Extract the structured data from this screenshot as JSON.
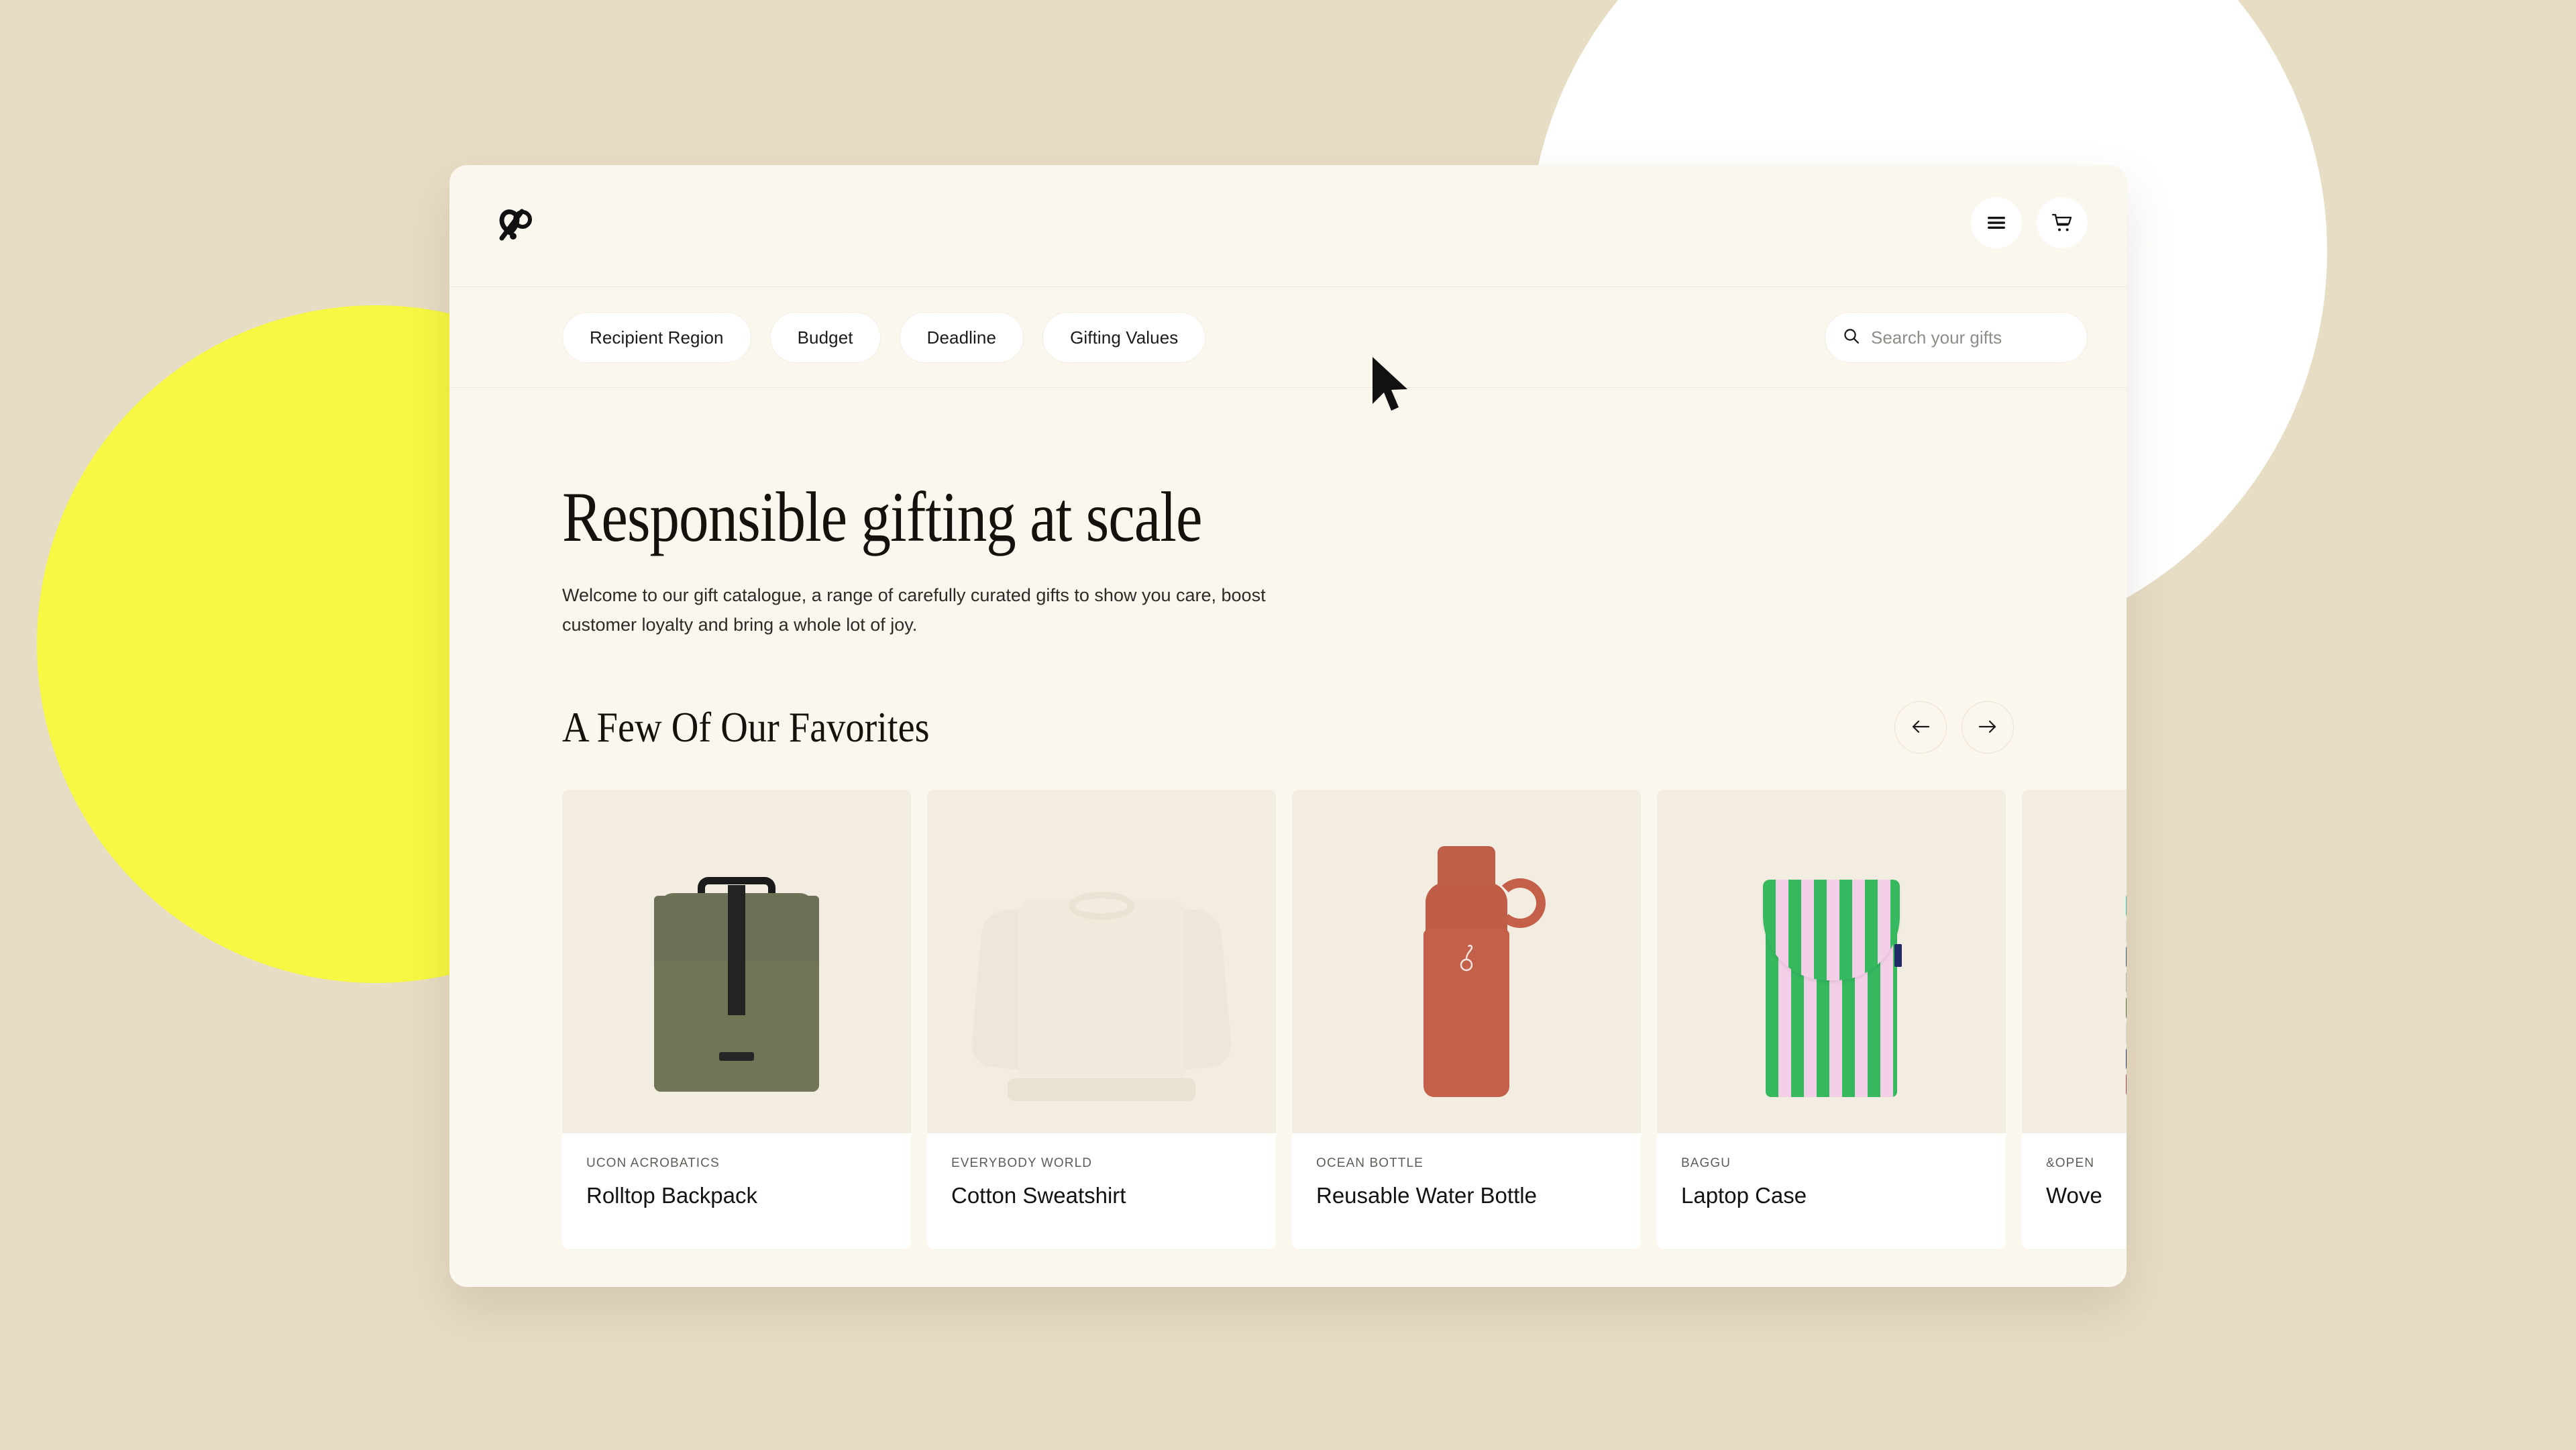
{
  "brand": {
    "logo_icon": "looped-ampersand-logo"
  },
  "topbar": {
    "menu_icon": "hamburger-menu-icon",
    "cart_icon": "shopping-cart-icon"
  },
  "filters": {
    "pills": [
      {
        "label": "Recipient Region"
      },
      {
        "label": "Budget"
      },
      {
        "label": "Deadline"
      },
      {
        "label": "Gifting Values"
      }
    ]
  },
  "search": {
    "icon": "search-icon",
    "placeholder": "Search your gifts",
    "value": ""
  },
  "hero": {
    "title": "Responsible gifting at scale",
    "subtitle": "Welcome to our gift catalogue, a range of carefully curated gifts to show you care, boost customer loyalty and bring a whole lot of joy."
  },
  "favorites": {
    "heading": "A Few Of Our Favorites",
    "prev_icon": "arrow-left-icon",
    "next_icon": "arrow-right-icon",
    "products": [
      {
        "brand": "UCON ACROBATICS",
        "name": "Rolltop Backpack",
        "image": "olive-rolltop-backpack"
      },
      {
        "brand": "EVERYBODY WORLD",
        "name": "Cotton Sweatshirt",
        "image": "cream-crewneck-sweatshirt"
      },
      {
        "brand": "OCEAN BOTTLE",
        "name": "Reusable Water Bottle",
        "image": "terracotta-water-bottle"
      },
      {
        "brand": "BAGGU",
        "name": "Laptop Case",
        "image": "green-pink-striped-laptop-sleeve"
      },
      {
        "brand": "&OPEN",
        "name": "Wove",
        "image": "stacked-woven-throws"
      }
    ]
  },
  "colors": {
    "page_background": "#e7dcc4",
    "accent_yellow": "#f7f843",
    "circle_white": "#ffffff",
    "app_background": "#fbf7ef",
    "card_background": "#ffffff",
    "text_primary": "#15120e",
    "text_muted": "#5d5d58"
  },
  "cursor": {
    "icon": "mouse-pointer-cursor"
  }
}
